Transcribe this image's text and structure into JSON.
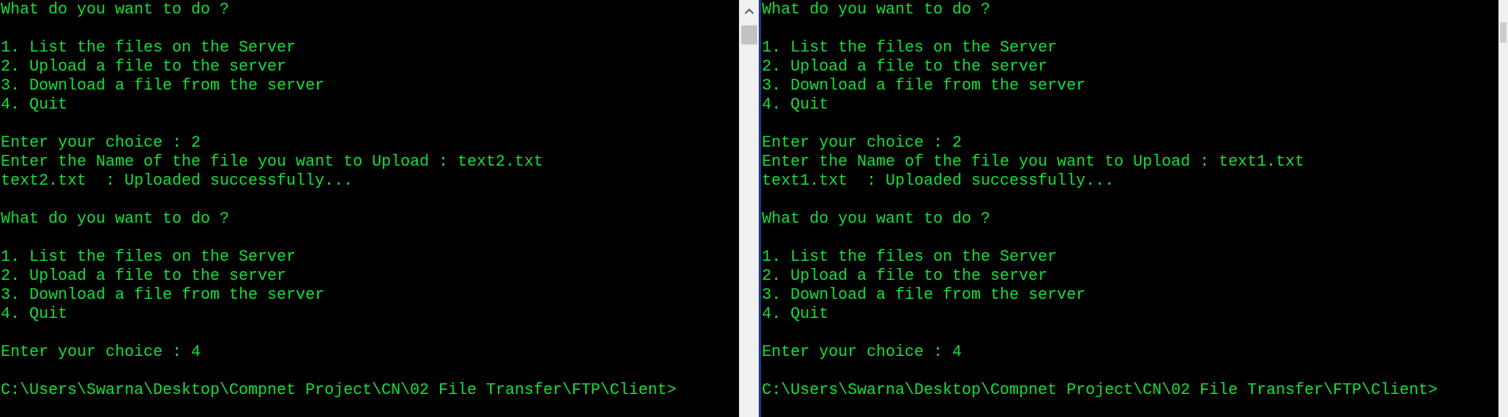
{
  "windows": [
    {
      "lines": [
        "What do you want to do ?",
        "",
        "1. List the files on the Server",
        "2. Upload a file to the server",
        "3. Download a file from the server",
        "4. Quit",
        "",
        "Enter your choice : 2",
        "Enter the Name of the file you want to Upload : text2.txt",
        "text2.txt  : Uploaded successfully...",
        "",
        "What do you want to do ?",
        "",
        "1. List the files on the Server",
        "2. Upload a file to the server",
        "3. Download a file from the server",
        "4. Quit",
        "",
        "Enter your choice : 4",
        "",
        "C:\\Users\\Swarna\\Desktop\\Compnet Project\\CN\\02 File Transfer\\FTP\\Client>"
      ]
    },
    {
      "lines": [
        "What do you want to do ?",
        "",
        "1. List the files on the Server",
        "2. Upload a file to the server",
        "3. Download a file from the server",
        "4. Quit",
        "",
        "Enter your choice : 2",
        "Enter the Name of the file you want to Upload : text1.txt",
        "text1.txt  : Uploaded successfully...",
        "",
        "What do you want to do ?",
        "",
        "1. List the files on the Server",
        "2. Upload a file to the server",
        "3. Download a file from the server",
        "4. Quit",
        "",
        "Enter your choice : 4",
        "",
        "C:\\Users\\Swarna\\Desktop\\Compnet Project\\CN\\02 File Transfer\\FTP\\Client>"
      ]
    }
  ],
  "colors": {
    "background": "#000000",
    "text": "#13e13b",
    "scrollbar": "#f0f0f0",
    "scrollbar_thumb": "#c2c2c2"
  },
  "icons": {
    "scroll_up": "chevron-up-icon"
  }
}
